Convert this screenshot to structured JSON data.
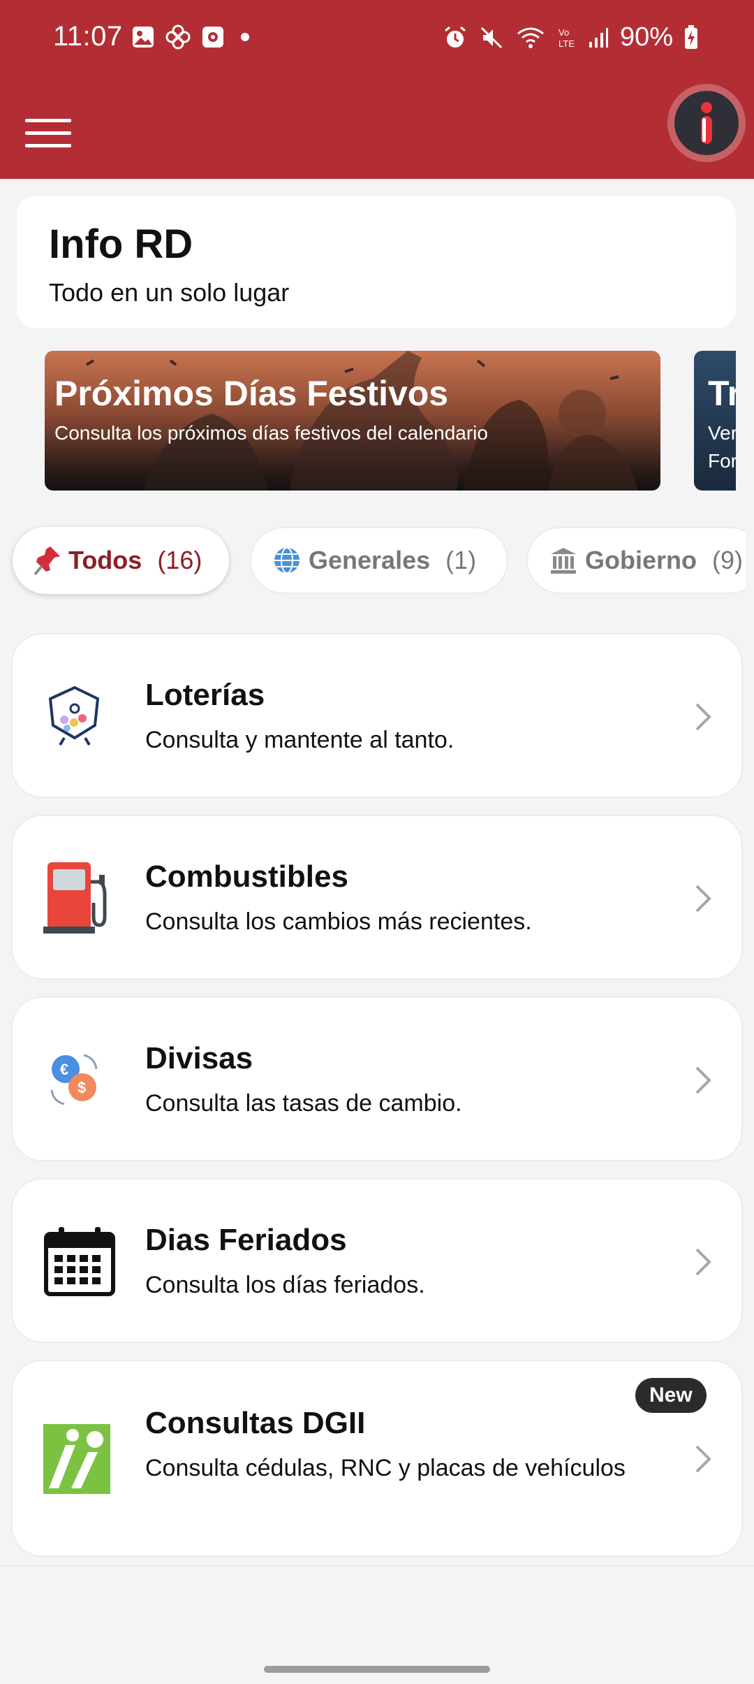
{
  "status_bar": {
    "time": "11:07",
    "battery": "90%",
    "icons": [
      "image-icon",
      "pinwheel-icon",
      "app-icon",
      "dot-icon",
      "alarm-icon",
      "mute-icon",
      "wifi-icon",
      "volte-icon",
      "signal-icon",
      "battery-charging-icon"
    ]
  },
  "app_bar": {
    "color": "#b32e34",
    "menu_icon": "hamburger-menu-icon",
    "info_icon": "info-icon"
  },
  "header": {
    "title": "Info RD",
    "subtitle": "Todo en un solo lugar"
  },
  "banners": [
    {
      "title": "Próximos Días Festivos",
      "subtitle": "Consulta los próximos días festivos del calendario"
    },
    {
      "title": "Tr",
      "subtitle_line1": "Ver",
      "subtitle_line2": "For"
    }
  ],
  "filters": [
    {
      "icon": "pushpin-icon",
      "label": "Todos",
      "count": "(16)",
      "active": true
    },
    {
      "icon": "globe-icon",
      "label": "Generales",
      "count": "(1)",
      "active": false
    },
    {
      "icon": "government-building-icon",
      "label": "Gobierno",
      "count": "(9)",
      "active": false
    }
  ],
  "items": [
    {
      "icon": "lottery-ball-icon",
      "title": "Loterías",
      "description": "Consulta y mantente al tanto."
    },
    {
      "icon": "fuel-pump-icon",
      "title": "Combustibles",
      "description": "Consulta los cambios más recientes."
    },
    {
      "icon": "currency-exchange-icon",
      "title": "Divisas",
      "description": "Consulta las tasas de cambio."
    },
    {
      "icon": "calendar-icon",
      "title": "Dias Feriados",
      "description": "Consulta los días feriados."
    },
    {
      "icon": "dgii-logo-icon",
      "title": "Consultas DGII",
      "description": "Consulta cédulas, RNC y placas de vehículos",
      "badge": "New"
    }
  ]
}
